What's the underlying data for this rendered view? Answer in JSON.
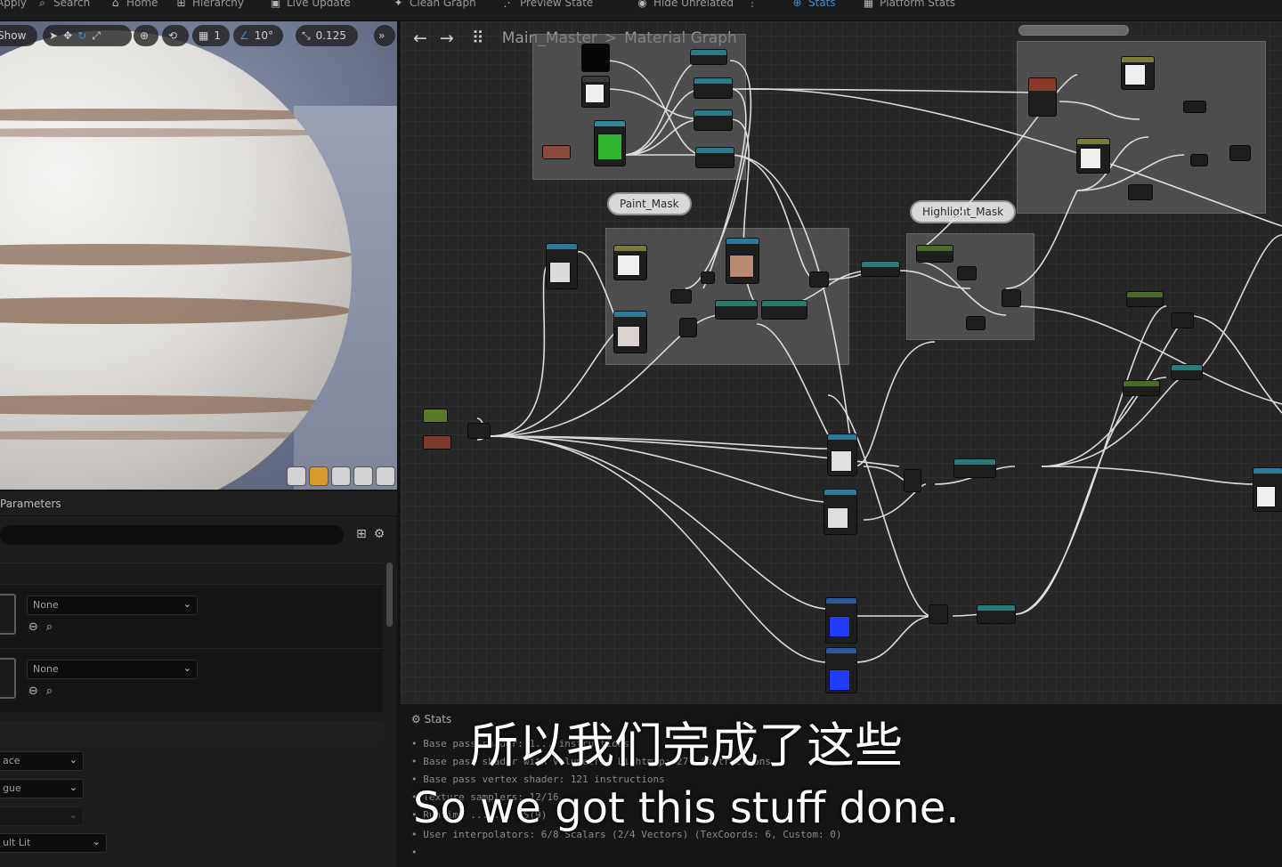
{
  "toolbar": {
    "items": [
      {
        "label": "Apply",
        "icon": "apply-icon"
      },
      {
        "label": "Search",
        "icon": "search-icon"
      },
      {
        "label": "Home",
        "icon": "home-icon"
      },
      {
        "label": "Hierarchy",
        "icon": "hierarchy-icon"
      },
      {
        "label": "Live Update",
        "icon": "live-update-icon"
      },
      {
        "label": "Clean Graph",
        "icon": "clean-graph-icon"
      },
      {
        "label": "Preview State",
        "icon": "preview-state-icon"
      },
      {
        "label": "Hide Unrelated",
        "icon": "hide-unrelated-icon"
      },
      {
        "label": "Stats",
        "icon": "stats-icon",
        "active": true
      },
      {
        "label": "Platform Stats",
        "icon": "platform-stats-icon"
      }
    ]
  },
  "viewport": {
    "show_label": "Show",
    "grid_value": "1",
    "angle_value": "10°",
    "scale_value": "0.125"
  },
  "parameters": {
    "title": "Parameters",
    "dropdown_1": "None",
    "dropdown_2": "None",
    "lower_dropdowns": [
      "ace",
      "gue",
      "",
      "ult Lit"
    ]
  },
  "graph": {
    "breadcrumb_root": "Main_Master",
    "breadcrumb_separator": ">",
    "breadcrumb_current": "Material Graph",
    "comments": [
      "Paint_Mask",
      "Highlight_Mask"
    ]
  },
  "stats": {
    "title": "Stats",
    "lines": [
      "Base pass shader: 1... instructions",
      "Base pass shader with Volumetric Lightmap: 27? instructions",
      "Base pass vertex shader: 121 instructions",
      "Texture samplers: 12/16",
      "Runtime ... ... PS(9)",
      "User interpolators: 6/8 Scalars (2/4 Vectors) (TexCoords: 6, Custom: 0)"
    ]
  },
  "subtitles": {
    "chinese": "所以我们完成了这些",
    "english": "So we got this stuff done."
  },
  "colors": {
    "accent": "#3b8ed6",
    "graph_bg": "#262626",
    "comment_box": "#6e6e6e",
    "wire": "#e8e8e8",
    "blue_param": "#1f3cff"
  }
}
